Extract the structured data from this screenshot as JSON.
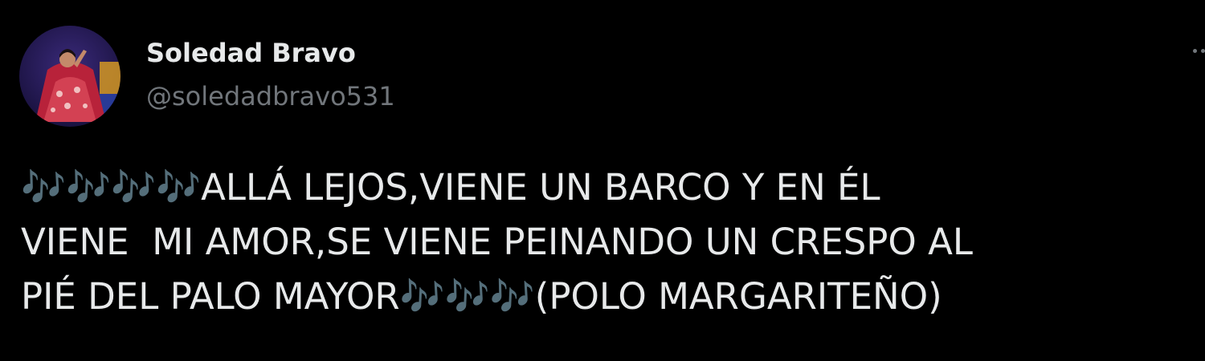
{
  "tweet": {
    "author": {
      "name": "Soledad Bravo",
      "handle": "@soledadbravo531"
    },
    "more_icon": "more-horizontal-icon",
    "text": {
      "notes_leading": "🎶🎶🎶🎶",
      "line1": "ALLÁ LEJOS,VIENE UN BARCO Y EN ÉL",
      "line2": "VIENE  MI AMOR,SE VIENE PEINANDO UN CRESPO AL",
      "line3": "PIÉ DEL PALO MAYOR",
      "notes_trailing": "🎶🎶🎶",
      "line3_end": "(POLO MARGARITEÑO)"
    },
    "colors": {
      "background": "#000000",
      "name": "#e7e9ea",
      "handle": "#71767b",
      "text": "#e7e9ea",
      "emoji": "#55acee"
    }
  }
}
